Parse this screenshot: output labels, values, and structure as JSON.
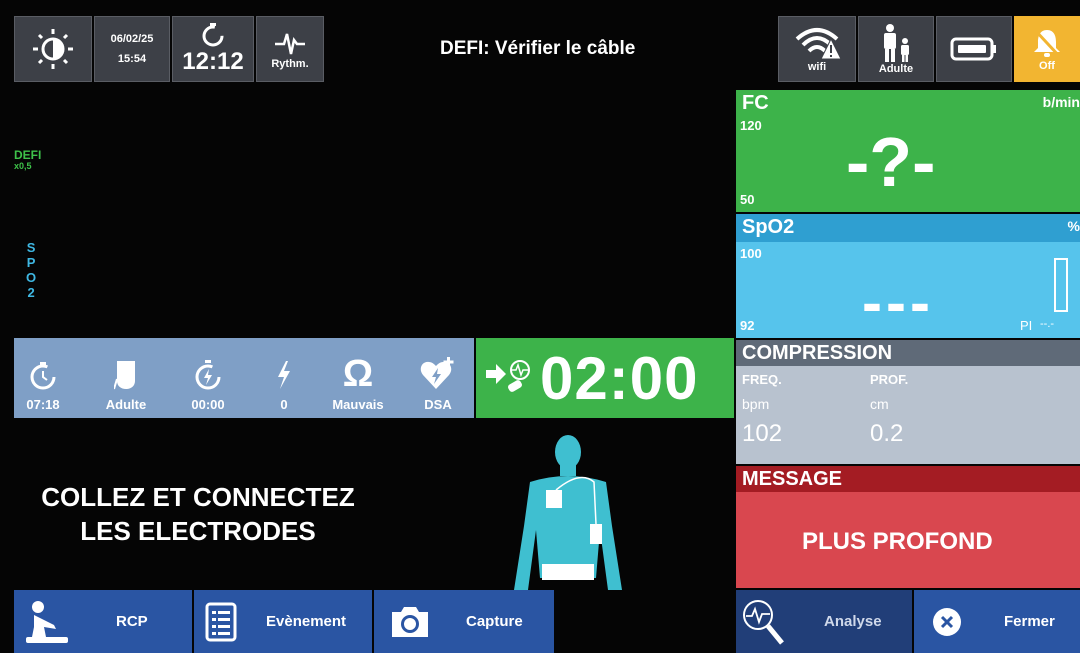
{
  "header": {
    "date": "06/02/25",
    "time": "15:54",
    "timer": "12:12",
    "rhythm_label": "Rythm.",
    "alert": "DEFI: Vérifier le câble",
    "wifi_label": "wifi",
    "patient_label": "Adulte",
    "alarm_label": "Off"
  },
  "left_labels": {
    "defi": "DEFI",
    "defi_scale": "x0,5",
    "spo2_letters": [
      "S",
      "P",
      "O",
      "2"
    ]
  },
  "fc": {
    "title": "FC",
    "unit": "b/min",
    "upper": "120",
    "lower": "50",
    "value": "-?-"
  },
  "spo2": {
    "title": "SpO2",
    "unit": "%",
    "upper": "100",
    "lower": "92",
    "value": "---",
    "pi_label": "PI",
    "pi_value": "--.-"
  },
  "status": {
    "elapsed": "07:18",
    "patient": "Adulte",
    "shock_timer": "00:00",
    "shock_count": "0",
    "impedance": "Mauvais",
    "mode": "DSA",
    "countdown": "02:00"
  },
  "compression": {
    "title": "COMPRESSION",
    "freq_label": "FREQ.",
    "freq_unit": "bpm",
    "freq_value": "102",
    "depth_label": "PROF.",
    "depth_unit": "cm",
    "depth_value": "0.2"
  },
  "message": {
    "title": "MESSAGE",
    "text": "PLUS PROFOND"
  },
  "instruction": {
    "line1": "COLLEZ ET CONNECTEZ",
    "line2": "LES ELECTRODES"
  },
  "bottom": {
    "rcp": "RCP",
    "event": "Evènement",
    "capture": "Capture",
    "analyse": "Analyse",
    "close": "Fermer"
  },
  "colors": {
    "green": "#3db34a",
    "cyan": "#3fb8e3",
    "grey_panel": "#b8c2cf",
    "red": "#d9474f",
    "blue_btn": "#2a55a3",
    "alarm_yellow": "#f2b531"
  }
}
